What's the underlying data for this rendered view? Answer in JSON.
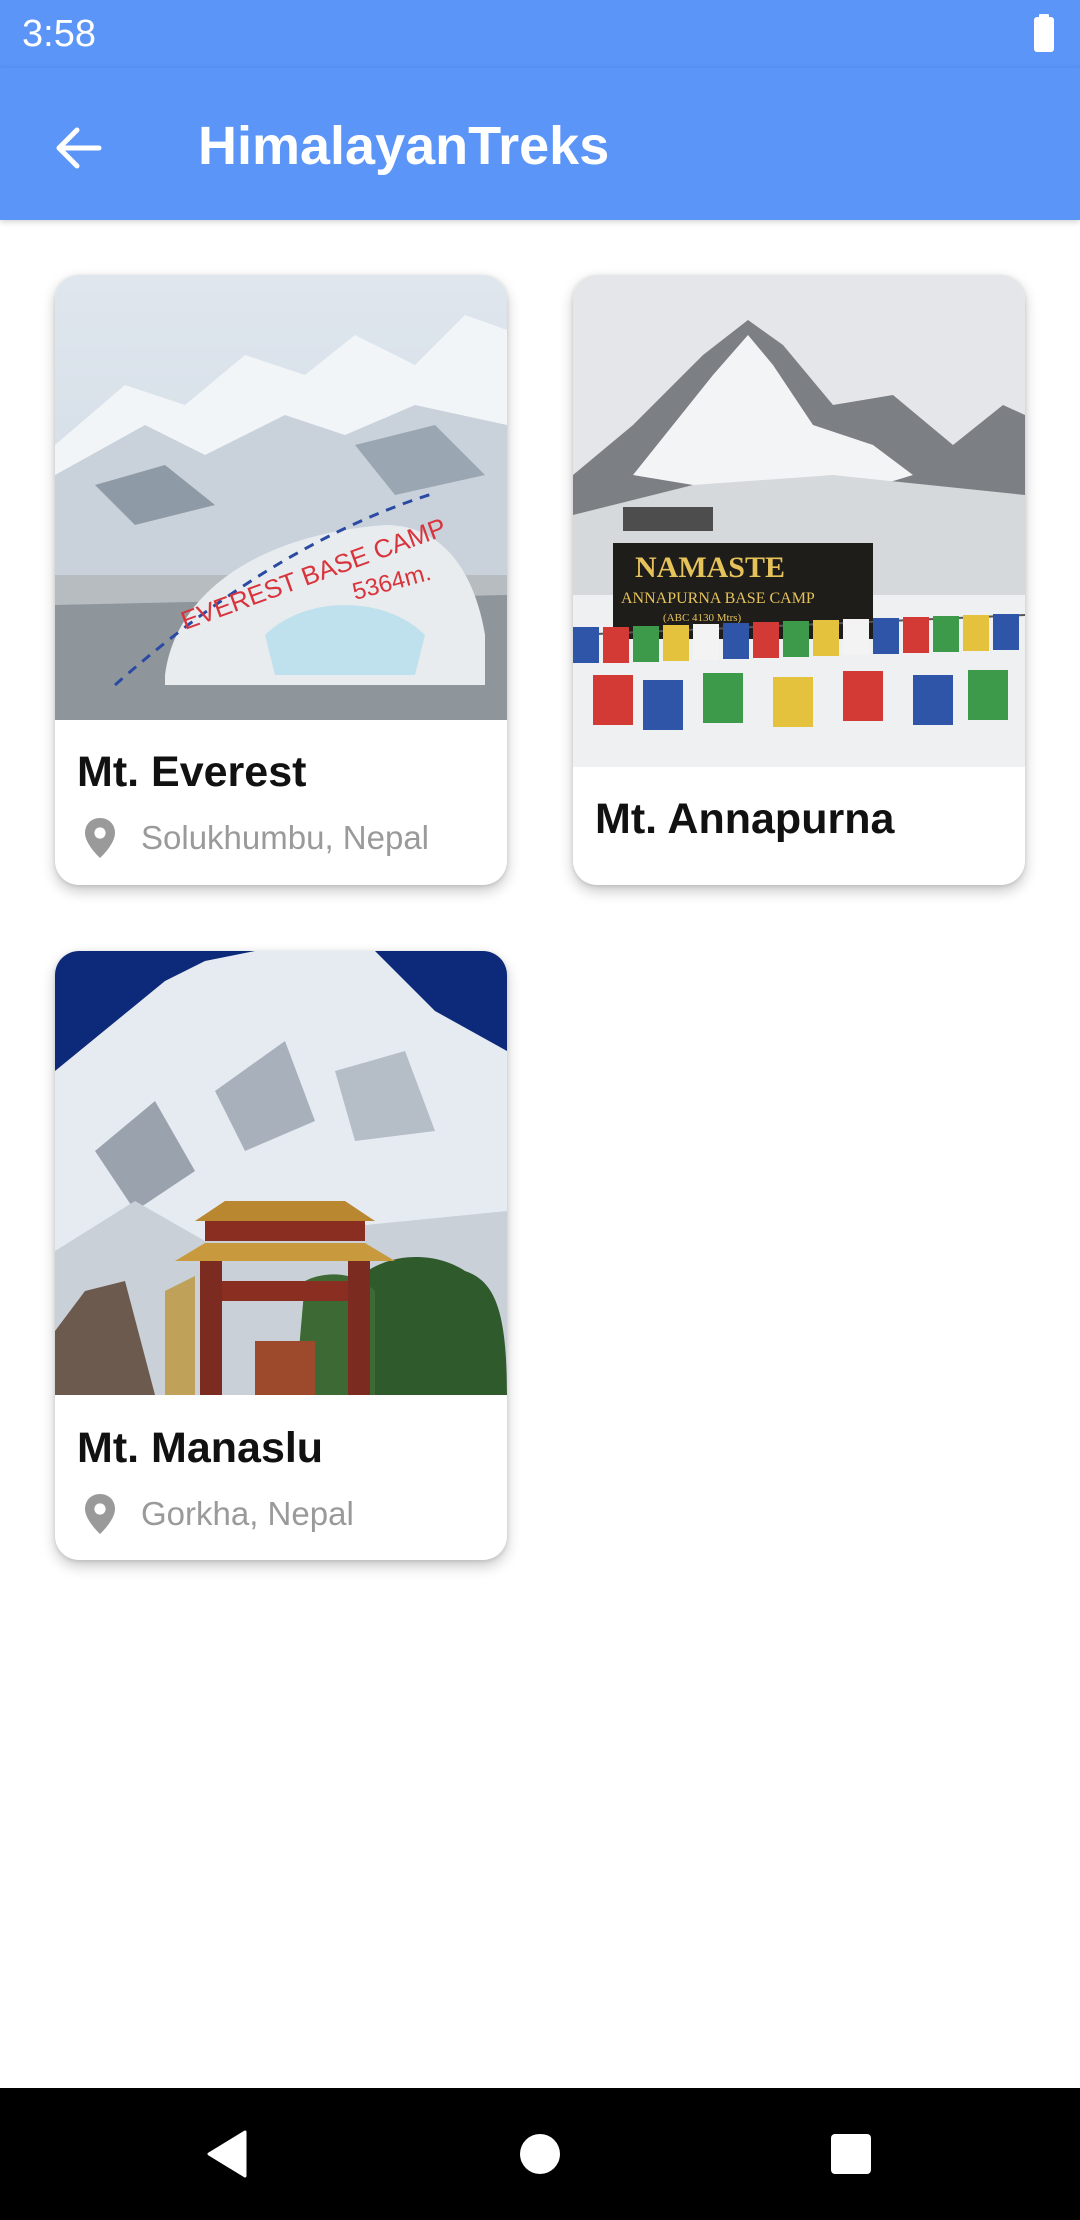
{
  "status_bar": {
    "time": "3:58",
    "battery_icon": "battery-full-icon"
  },
  "app_bar": {
    "back_icon": "arrow-back-icon",
    "title": "HimalayanTreks"
  },
  "colors": {
    "primary": "#5b95f7",
    "card_title": "#111111",
    "location_text": "#9a9a9a"
  },
  "treks": [
    {
      "name": "Mt. Everest",
      "location": "Solukhumbu, Nepal",
      "image_icon": "everest-base-camp-photo"
    },
    {
      "name": "Mt. Annapurna",
      "location": "",
      "image_icon": "annapurna-base-camp-photo"
    },
    {
      "name": "Mt. Manaslu",
      "location": "Gorkha, Nepal",
      "image_icon": "manaslu-gate-photo"
    }
  ],
  "nav_bar": {
    "back_icon": "triangle-back-icon",
    "home_icon": "circle-home-icon",
    "recents_icon": "square-recents-icon"
  }
}
